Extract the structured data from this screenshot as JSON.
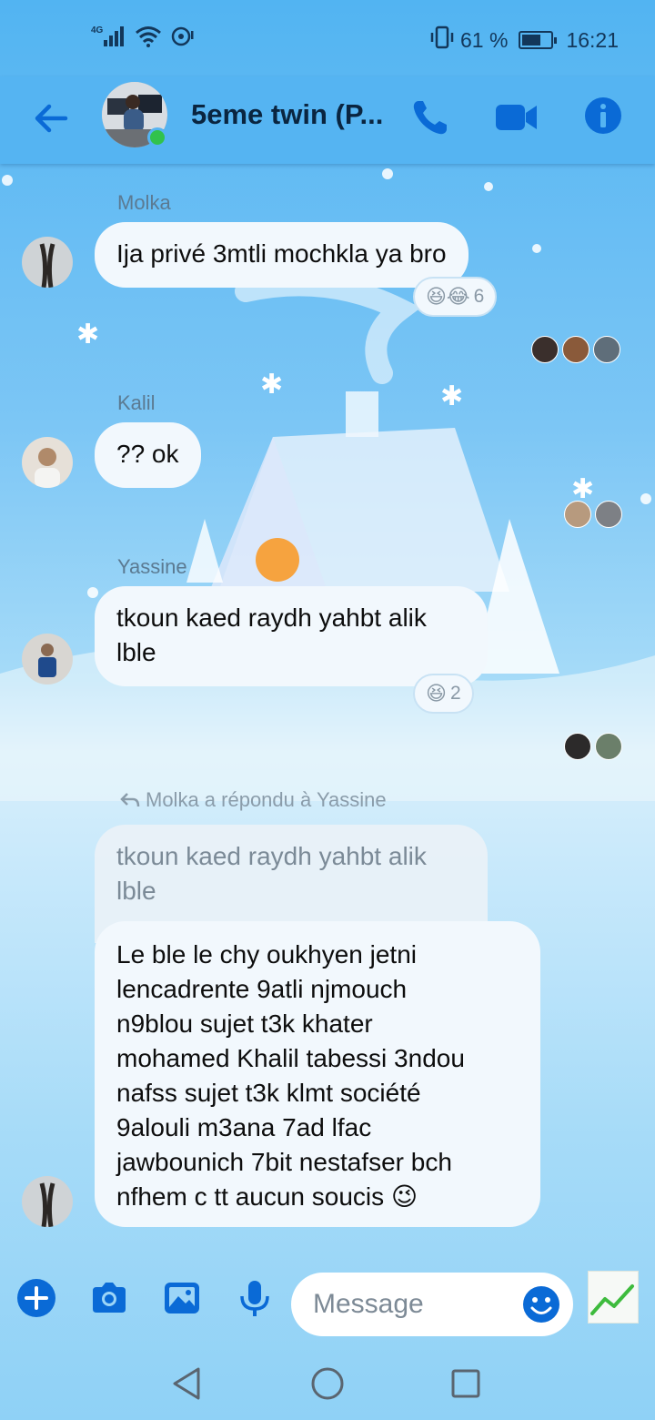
{
  "status_bar": {
    "network": "4G",
    "battery_percent": "61 %",
    "battery_level": 0.61,
    "time": "16:21"
  },
  "header": {
    "title": "5eme twin (P...",
    "icons": [
      "back-arrow-icon",
      "phone-icon",
      "video-camera-icon",
      "info-icon"
    ],
    "accent_color": "#0a6ad6"
  },
  "messages": [
    {
      "sender": "Molka",
      "text": "Ija privé 3mtli mochkla ya bro",
      "reactions": {
        "emojis": "😆😂",
        "count": "6"
      }
    },
    {
      "sender": "Kalil",
      "text": "?? ok"
    },
    {
      "sender": "Yassine",
      "lines": [
        "tkoun kaed raydh yahbt alik",
        "lble"
      ],
      "reactions": {
        "emojis": "😆",
        "count": "2"
      }
    }
  ],
  "reply": {
    "note": "Molka a répondu à Yassine",
    "quoted_lines": [
      "tkoun kaed raydh yahbt alik",
      "lble"
    ],
    "lines": [
      "Le ble le chy oukhyen jetni",
      "lencadrente 9atli njmouch",
      "n9blou sujet t3k khater",
      "mohamed Khalil tabessi 3ndou",
      "nafss sujet t3k klmt société",
      "9alouli m3ana 7ad lfac",
      "jawbounich 7bit nestafser bch",
      "nfhem c tt aucun soucis 😉"
    ]
  },
  "composer": {
    "placeholder": "Message",
    "icons": [
      "plus-icon",
      "camera-icon",
      "gallery-icon",
      "microphone-icon",
      "emoji-icon",
      "sticker-icon"
    ]
  },
  "nav": {
    "icons": [
      "back-triangle-icon",
      "home-circle-icon",
      "recents-square-icon"
    ]
  }
}
